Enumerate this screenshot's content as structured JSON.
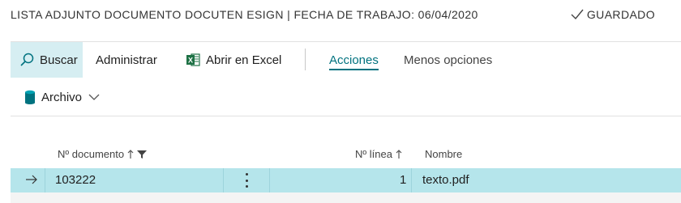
{
  "header": {
    "title": "LISTA ADJUNTO DOCUMENTO DOCUTEN ESIGN | FECHA DE TRABAJO: 06/04/2020",
    "saved_status": "GUARDADO"
  },
  "actions": {
    "search": "Buscar",
    "manage": "Administrar",
    "excel": "Abrir en Excel",
    "acciones": "Acciones",
    "fewer_options": "Menos opciones",
    "archivo": "Archivo"
  },
  "columns": {
    "doc_no": "Nº documento",
    "line_no": "Nº línea",
    "name": "Nombre"
  },
  "rows": [
    {
      "doc_no": "103222",
      "line_no": "1",
      "name": "texto.pdf"
    }
  ],
  "colors": {
    "accent": "#00727f",
    "selected_row": "#b5e5eb",
    "excel_green": "#1e7145",
    "archive_teal": "#00727f"
  },
  "icons": {
    "search": "search-icon",
    "excel": "excel-icon",
    "archive": "database-icon",
    "check": "check-icon",
    "sort": "sort-up-icon",
    "filter": "filter-icon",
    "row_arrow": "arrow-right-icon",
    "more": "more-vertical-icon"
  }
}
